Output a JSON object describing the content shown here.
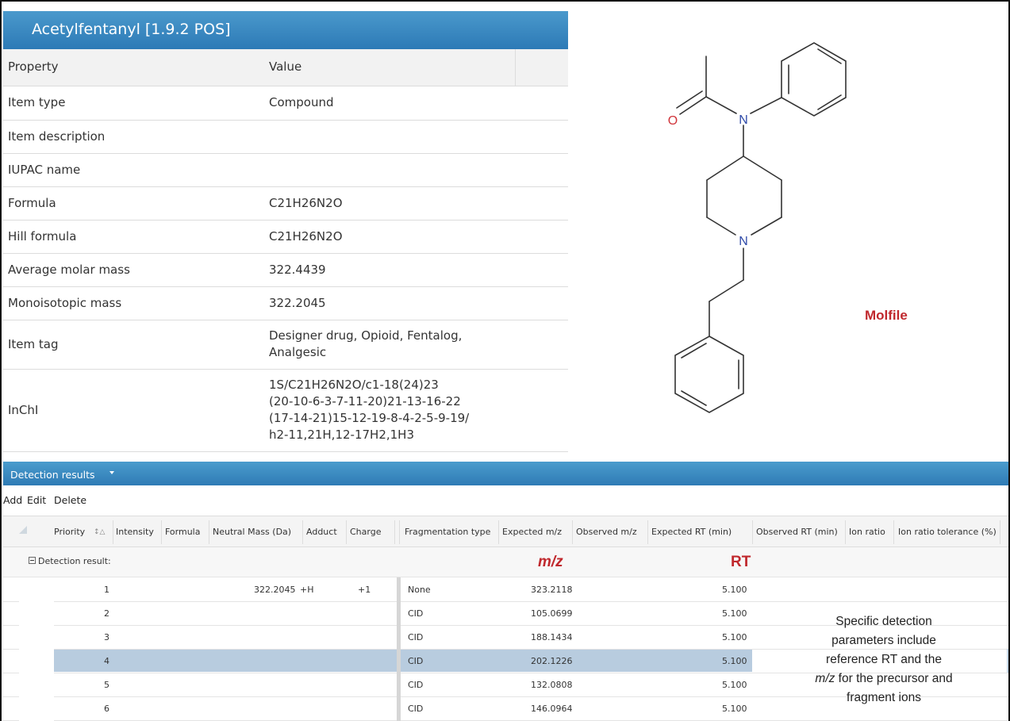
{
  "property_panel": {
    "title": "Acetylfentanyl  [1.9.2 POS]",
    "header": {
      "property": "Property",
      "value": "Value"
    },
    "rows": [
      {
        "property": "Item type",
        "value": "Compound"
      },
      {
        "property": "Item description",
        "value": ""
      },
      {
        "property": "IUPAC name",
        "value": ""
      },
      {
        "property": "Formula",
        "value": "C21H26N2O"
      },
      {
        "property": "Hill formula",
        "value": "C21H26N2O"
      },
      {
        "property": "Average molar mass",
        "value": "322.4439"
      },
      {
        "property": "Monoisotopic mass",
        "value": "322.2045"
      },
      {
        "property": "Item tag",
        "value": "Designer drug, Opioid, Fentalog, Analgesic"
      },
      {
        "property": "InChI",
        "value": "1S/C21H26N2O/c1-18(24)23(20-10-6-3-7-11-20)21-13-16-22(17-14-21)15-12-19-8-4-2-5-9-19/h2-11,21H,12-17H2,1H3"
      }
    ],
    "item_tag_lines": [
      "Designer drug, Opioid, Fentalog,",
      "Analgesic"
    ],
    "inchi_lines": [
      "1S/C21H26N2O/c1-18(24)23",
      "(20-10-6-3-7-11-20)21-13-16-22",
      "(17-14-21)15-12-19-8-4-2-5-9-19/",
      "h2-11,21H,12-17H2,1H3"
    ]
  },
  "structure": {
    "atom_labels": {
      "oxygen": "O",
      "nitrogen_amide": "N",
      "nitrogen_ring": "N"
    },
    "caption": "Molfile",
    "colors": {
      "oxygen": "#d0343a",
      "nitrogen": "#2f4aa8",
      "bond": "#333333",
      "caption": "#c0282d"
    }
  },
  "detection": {
    "title": "Detection results",
    "toolbar": {
      "add": "Add",
      "edit": "Edit",
      "delete": "Delete"
    },
    "columns": {
      "priority": "Priority",
      "sort_glyph": "↕△",
      "intensity": "Intensity",
      "formula": "Formula",
      "neutral_mass": "Neutral Mass (Da)",
      "adduct": "Adduct",
      "charge": "Charge",
      "fragmentation_type": "Fragmentation type",
      "expected_mz": "Expected m/z",
      "observed_mz": "Observed m/z",
      "expected_rt": "Expected RT (min)",
      "observed_rt": "Observed RT (min)",
      "ion_ratio": "Ion ratio",
      "ion_ratio_tolerance": "Ion ratio tolerance (%)"
    },
    "group_label": "Detection result:",
    "mz_label": "m/z",
    "rt_label": "RT",
    "selected_priority": "4",
    "rows": [
      {
        "priority": "1",
        "neutral_mass": "322.2045",
        "adduct": "+H",
        "charge": "+1",
        "fragmentation_type": "None",
        "expected_mz": "323.2118",
        "expected_rt": "5.100"
      },
      {
        "priority": "2",
        "neutral_mass": "",
        "adduct": "",
        "charge": "",
        "fragmentation_type": "CID",
        "expected_mz": "105.0699",
        "expected_rt": "5.100"
      },
      {
        "priority": "3",
        "neutral_mass": "",
        "adduct": "",
        "charge": "",
        "fragmentation_type": "CID",
        "expected_mz": "188.1434",
        "expected_rt": "5.100"
      },
      {
        "priority": "4",
        "neutral_mass": "",
        "adduct": "",
        "charge": "",
        "fragmentation_type": "CID",
        "expected_mz": "202.1226",
        "expected_rt": "5.100"
      },
      {
        "priority": "5",
        "neutral_mass": "",
        "adduct": "",
        "charge": "",
        "fragmentation_type": "CID",
        "expected_mz": "132.0808",
        "expected_rt": "5.100"
      },
      {
        "priority": "6",
        "neutral_mass": "",
        "adduct": "",
        "charge": "",
        "fragmentation_type": "CID",
        "expected_mz": "146.0964",
        "expected_rt": "5.100"
      }
    ],
    "accent_colors": {
      "header_bar": "#2f7bb5",
      "selection": "#b8ccdf",
      "annotation": "#c0282d"
    }
  },
  "annotation": {
    "lines": [
      "Specific detection",
      "parameters include",
      "reference RT and the"
    ],
    "line4_italic": "m/z",
    "line4_rest": " for the precursor and",
    "line5": "fragment ions"
  }
}
